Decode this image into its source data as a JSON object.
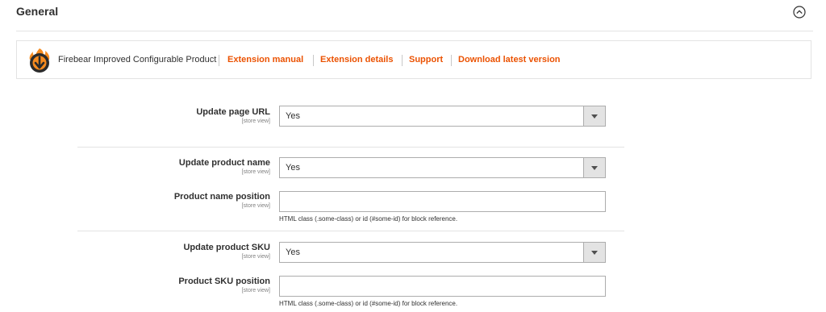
{
  "section": {
    "title": "General"
  },
  "extension": {
    "name": "Firebear Improved Configurable Product",
    "links": [
      {
        "label": "Extension manual"
      },
      {
        "label": "Extension details"
      },
      {
        "label": "Support"
      },
      {
        "label": "Download latest version"
      }
    ]
  },
  "fields": {
    "update_page_url": {
      "label": "Update page URL",
      "scope": "[store view]",
      "value": "Yes"
    },
    "update_product_name": {
      "label": "Update product name",
      "scope": "[store view]",
      "value": "Yes"
    },
    "product_name_position": {
      "label": "Product name position",
      "scope": "[store view]",
      "value": "",
      "note": "HTML class (.some-class) or id (#some-id) for block reference."
    },
    "update_product_sku": {
      "label": "Update product SKU",
      "scope": "[store view]",
      "value": "Yes"
    },
    "product_sku_position": {
      "label": "Product SKU position",
      "scope": "[store view]",
      "value": "",
      "note": "HTML class (.some-class) or id (#some-id) for block reference."
    }
  },
  "colors": {
    "accent": "#eb5202",
    "logo_dark": "#2b2b2b",
    "logo_flame": "#f68b1f"
  }
}
